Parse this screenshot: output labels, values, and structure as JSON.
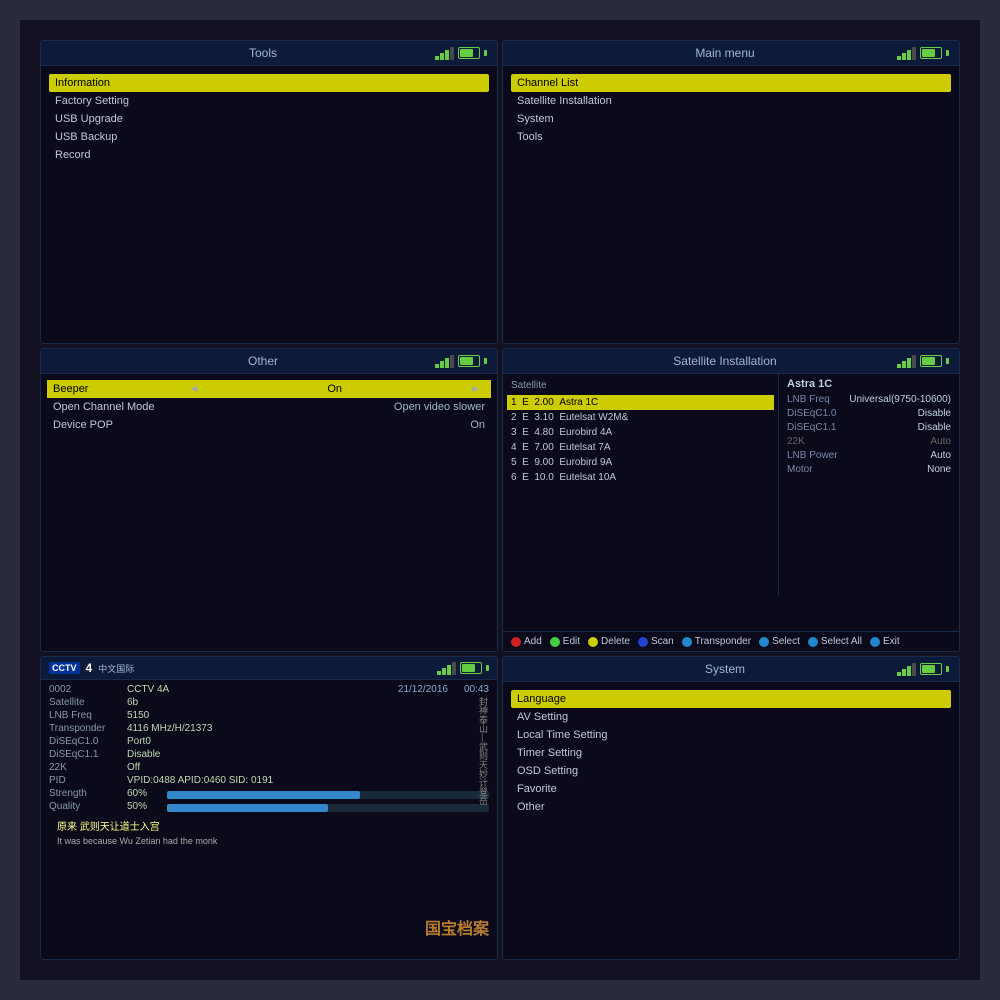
{
  "tools": {
    "title": "Tools",
    "items": [
      {
        "label": "Information",
        "highlighted": true
      },
      {
        "label": "Factory Setting"
      },
      {
        "label": "USB Upgrade"
      },
      {
        "label": "USB Backup"
      },
      {
        "label": "Record"
      }
    ]
  },
  "mainmenu": {
    "title": "Main menu",
    "items": [
      {
        "label": "Channel List",
        "highlighted": true
      },
      {
        "label": "Satellite Installation"
      },
      {
        "label": "System"
      },
      {
        "label": "Tools"
      }
    ]
  },
  "other": {
    "title": "Other",
    "settings": [
      {
        "label": "Beeper",
        "value": "On",
        "hasArrows": true,
        "highlighted": true
      },
      {
        "label": "Open Channel Mode",
        "value": "Open video slower"
      },
      {
        "label": "Device POP",
        "value": "On"
      }
    ]
  },
  "satellite_installation": {
    "title": "Satellite Installation",
    "col_header": "Satellite",
    "satellites": [
      {
        "num": "1",
        "type": "E",
        "freq": "2.00",
        "name": "Astra 1C",
        "active": true
      },
      {
        "num": "2",
        "type": "E",
        "freq": "3.10",
        "name": "Eutelsat W2M&"
      },
      {
        "num": "3",
        "type": "E",
        "freq": "4.80",
        "name": "Eurobird 4A"
      },
      {
        "num": "4",
        "type": "E",
        "freq": "7.00",
        "name": "Eutelsat 7A"
      },
      {
        "num": "5",
        "type": "E",
        "freq": "9.00",
        "name": "Eurobird 9A"
      },
      {
        "num": "6",
        "type": "E",
        "freq": "10.0",
        "name": "Eutelsat 10A"
      }
    ],
    "details": {
      "name": "Astra 1C",
      "lnb_freq_label": "LNB Freq",
      "lnb_freq_value": "Universal(9750-10600)",
      "diseqc10_label": "DiSEqC1.0",
      "diseqc10_value": "Disable",
      "diseqc11_label": "DiSEqC1.1",
      "diseqc11_value": "Disable",
      "22k_label": "22K",
      "22k_value": "Auto",
      "lnb_power_label": "LNB Power",
      "lnb_power_value": "Auto",
      "motor_label": "Motor",
      "motor_value": "None"
    },
    "buttons": [
      {
        "color": "red",
        "label": "Add"
      },
      {
        "color": "green",
        "label": "Edit"
      },
      {
        "color": "yellow",
        "label": "Delete"
      },
      {
        "color": "blue",
        "label": "Scan"
      },
      {
        "color": "cyan",
        "label": "Transponder"
      },
      {
        "color": "cyan2",
        "label": "Select"
      },
      {
        "color": "cyan3",
        "label": "Select All"
      },
      {
        "color": "cyan4",
        "label": "Exit"
      }
    ]
  },
  "system": {
    "title": "System",
    "items": [
      {
        "label": "Language",
        "highlighted": true
      },
      {
        "label": "AV Setting"
      },
      {
        "label": "Local Time Setting"
      },
      {
        "label": "Timer Setting"
      },
      {
        "label": "OSD Setting"
      },
      {
        "label": "Favorite"
      },
      {
        "label": "Other"
      }
    ]
  },
  "channel": {
    "logo": "CCTV",
    "number": "4",
    "name_zh": "中文国际",
    "program_num": "0002",
    "program_name": "CCTV 4A",
    "date": "21/12/2016",
    "time": "00:43",
    "satellite_label": "Satellite",
    "satellite_value": "6b",
    "lnb_freq_label": "LNB Freq",
    "lnb_freq_value": "5150",
    "transponder_label": "Transponder",
    "transponder_value": "4116 MHz/H/21373",
    "diseqc10_label": "DiSEqC1.0",
    "diseqc10_value": "Port0",
    "diseqc11_label": "DiSEqC1.1",
    "diseqc11_value": "Disable",
    "k22_label": "22K",
    "k22_value": "Off",
    "pid_label": "PID",
    "pid_value": "VPID:0488 APID:0460 SID: 0191",
    "strength_label": "Strength",
    "strength_pct": "60%",
    "strength_val": 60,
    "quality_label": "Quality",
    "quality_pct": "50%",
    "quality_val": 50,
    "subtitle": "原来 武则天让道士入宫",
    "subtitle_en": "It was because Wu Zetian had the monk",
    "watermark": "国宝档案",
    "vertical_text": "封神泰山—武则天妙计登岳"
  }
}
